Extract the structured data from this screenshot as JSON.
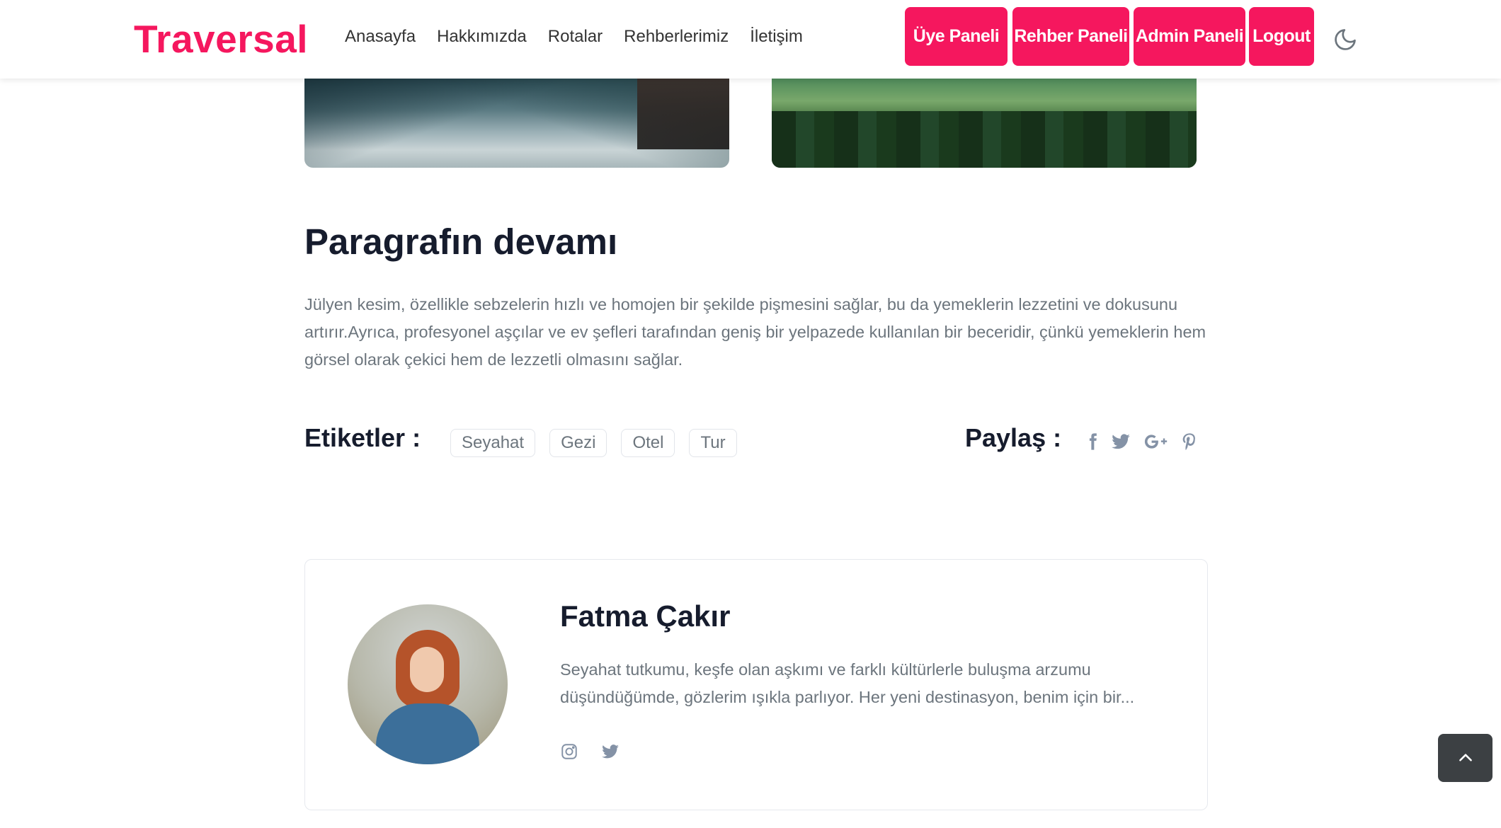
{
  "header": {
    "logo": "Traversal",
    "nav": [
      "Anasayfa",
      "Hakkımızda",
      "Rotalar",
      "Rehberlerimiz",
      "İletişim"
    ],
    "panel_buttons": [
      "Üye Paneli",
      "Rehber Paneli",
      "Admin Paneli",
      "Logout"
    ],
    "theme_icon": "moon-icon"
  },
  "article": {
    "heading": "Paragrafın devamı",
    "paragraph": "Jülyen kesim, özellikle sebzelerin hızlı ve homojen bir şekilde pişmesini sağlar, bu da yemeklerin lezzetini ve dokusunu artırır.Ayrıca, profesyonel aşçılar ve ev şefleri tarafından geniş bir yelpazede kullanılan bir beceridir, çünkü yemeklerin hem görsel olarak çekici hem de lezzetli olmasını sağlar.",
    "tags_label": "Etiketler :",
    "tags": [
      "Seyahat",
      "Gezi",
      "Otel",
      "Tur"
    ],
    "share_label": "Paylaş :",
    "share_icons": [
      "facebook-icon",
      "twitter-icon",
      "google-plus-icon",
      "pinterest-icon"
    ]
  },
  "author": {
    "name": "Fatma Çakır",
    "bio": "Seyahat tutkumu, keşfe olan aşkımı ve farklı kültürlerle buluşma arzumu düşündüğümde, gözlerim ışıkla parlıyor. Her yeni destinasyon, benim için bir...",
    "social_icons": [
      "instagram-icon",
      "twitter-icon"
    ]
  },
  "colors": {
    "accent": "#f5175e",
    "heading": "#161c2d",
    "muted": "#6c757d"
  }
}
